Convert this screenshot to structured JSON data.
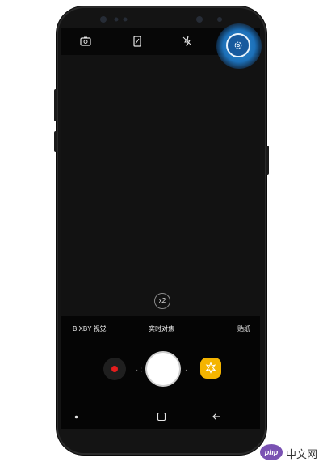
{
  "camera": {
    "top_icons": [
      "switch-camera-icon",
      "aspect-ratio-icon",
      "flash-off-icon",
      "settings-icon"
    ],
    "zoom_label": "x2",
    "modes": {
      "left": "BIXBY 视觉",
      "center": "实时对焦",
      "right": "贴纸"
    },
    "controls": [
      "record-icon",
      "shutter-button",
      "bixby-vision-icon"
    ]
  },
  "navbar": {
    "icons": [
      "dot-icon",
      "recent-apps-icon",
      "back-icon"
    ]
  },
  "watermark": {
    "logo": "php",
    "text": "中文网"
  },
  "colors": {
    "highlight": "#1c6fb7",
    "record": "#e51d1d",
    "bixby": "#f4b400"
  }
}
